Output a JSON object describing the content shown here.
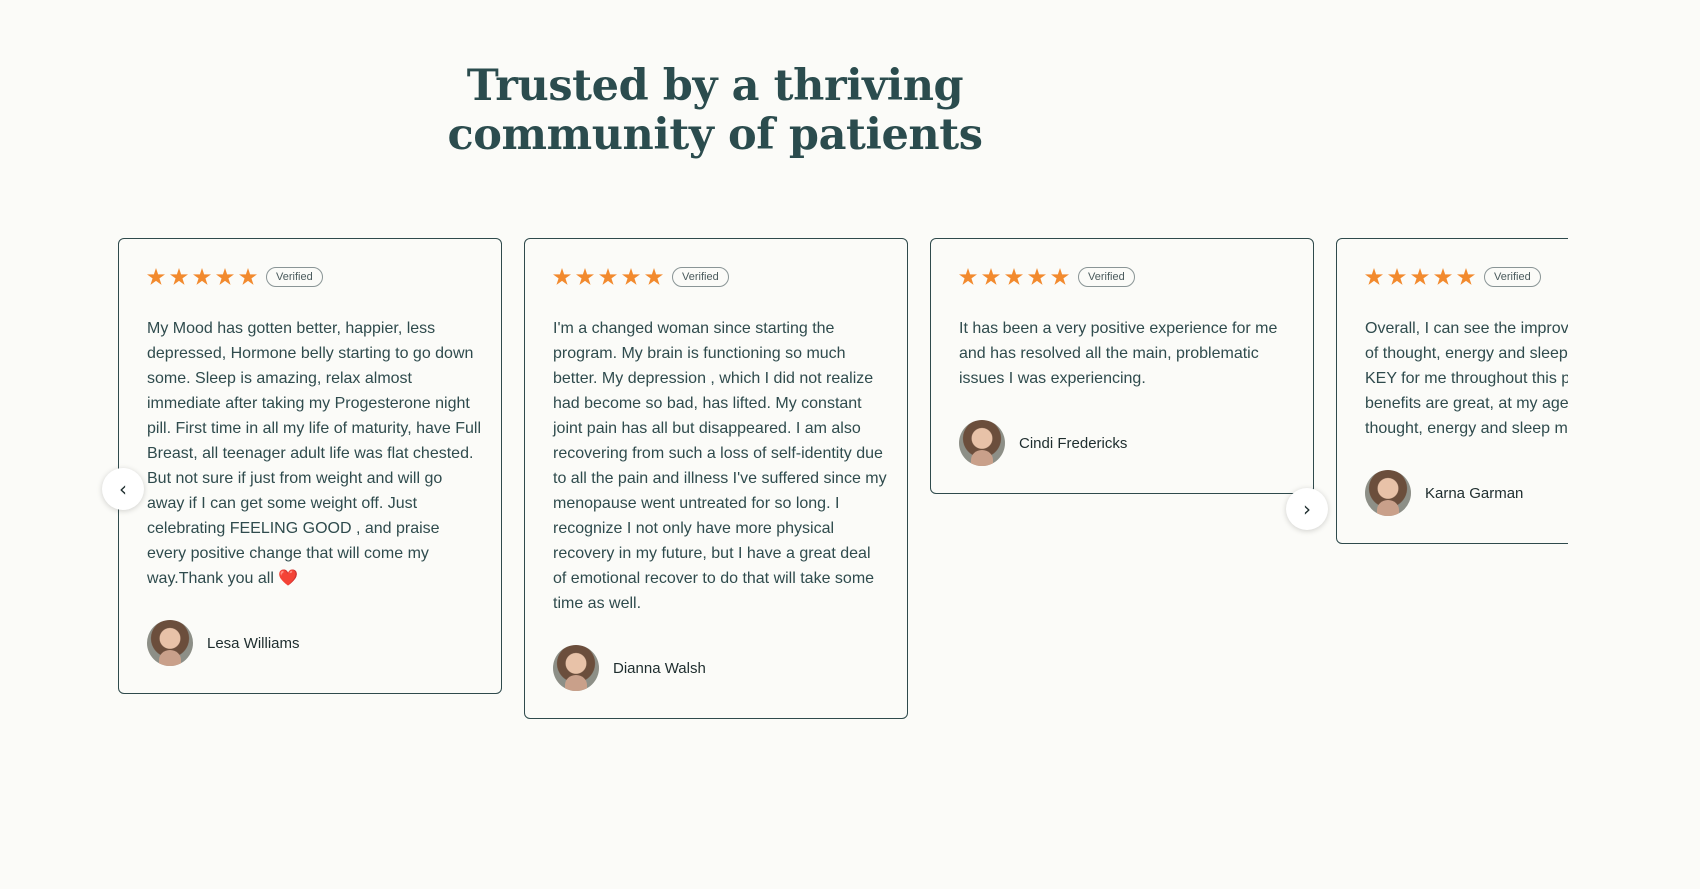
{
  "section": {
    "heading_line1": "Trusted by a thriving",
    "heading_line2": "community of patients"
  },
  "badge_label": "Verified",
  "star_color": "#f28a2e",
  "rating_stars": 5,
  "reviews": [
    {
      "text": "My Mood has gotten better, happier, less depressed, Hormone belly starting to go down some. Sleep is amazing, relax almost immediate after taking my Progesterone night pill. First time in all my life of maturity, have Full Breast, all teenager adult life was flat chested. But not sure if just from weight and will go away if I can get some weight off. Just celebrating FEELING GOOD , and praise every positive change that will come my way.Thank you all ❤️",
      "author": "Lesa Williams"
    },
    {
      "text": "I'm a changed woman since starting the program. My brain is functioning so much better. My depression , which I did not realize had become so bad, has lifted. My constant joint pain has all but disappeared. I am also recovering from such a loss of self-identity due to all the pain and illness I've suffered since my menopause went untreated for so long. I recognize I not only have more physical recovery in my future, but I have a great deal of emotional recover to do that will take some time as well.",
      "author": "Dianna Walsh"
    },
    {
      "text": "It has been a very positive experience for me and has resolved all the main, problematic issues I was experiencing.",
      "author": "Cindi Fredericks"
    },
    {
      "text": "Overall, I can see the improvements in clarity of thought, energy and sleep that have been KEY for me throughout this program. The other benefits are great, at my age, I value the thought, energy and sleep most :)",
      "author": "Karna Garman"
    }
  ],
  "nav": {
    "prev_icon": "chevron-left-icon",
    "prev_glyph": "‹",
    "next_icon": "chevron-right-icon",
    "next_glyph": "›"
  }
}
